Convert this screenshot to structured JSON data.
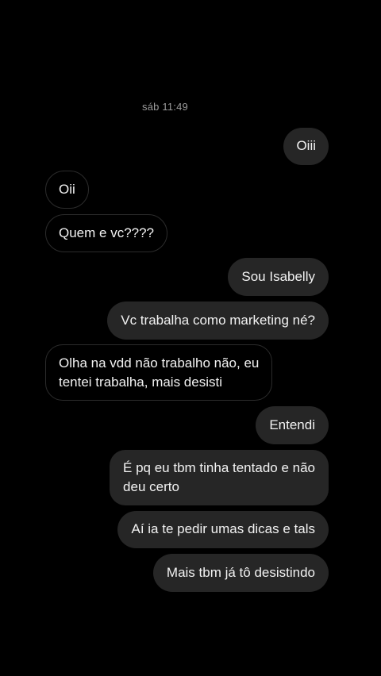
{
  "conversation": {
    "timestamp": "sáb 11:49",
    "messages": [
      {
        "direction": "sent",
        "lines": [
          "Oiii"
        ]
      },
      {
        "direction": "received",
        "lines": [
          "Oii"
        ]
      },
      {
        "direction": "received",
        "lines": [
          "Quem e vc????"
        ]
      },
      {
        "direction": "sent",
        "lines": [
          "Sou Isabelly"
        ]
      },
      {
        "direction": "sent",
        "lines": [
          "Vc trabalha como marketing né?"
        ]
      },
      {
        "direction": "received",
        "lines": [
          "Olha na vdd não trabalho não, eu",
          "tentei trabalha, mais desisti"
        ]
      },
      {
        "direction": "sent",
        "lines": [
          "Entendi"
        ]
      },
      {
        "direction": "sent",
        "lines": [
          "É pq eu tbm tinha tentado e não",
          "deu certo"
        ]
      },
      {
        "direction": "sent",
        "lines": [
          "Aí ia te pedir umas dicas e tals"
        ]
      },
      {
        "direction": "sent",
        "lines": [
          "Mais tbm já tô desistindo"
        ]
      }
    ]
  },
  "colors": {
    "background": "#000000",
    "sent_bubble": "#262626",
    "received_border": "#2c2c2c",
    "text": "#f2f2f2",
    "timestamp": "#9a9a9a"
  }
}
